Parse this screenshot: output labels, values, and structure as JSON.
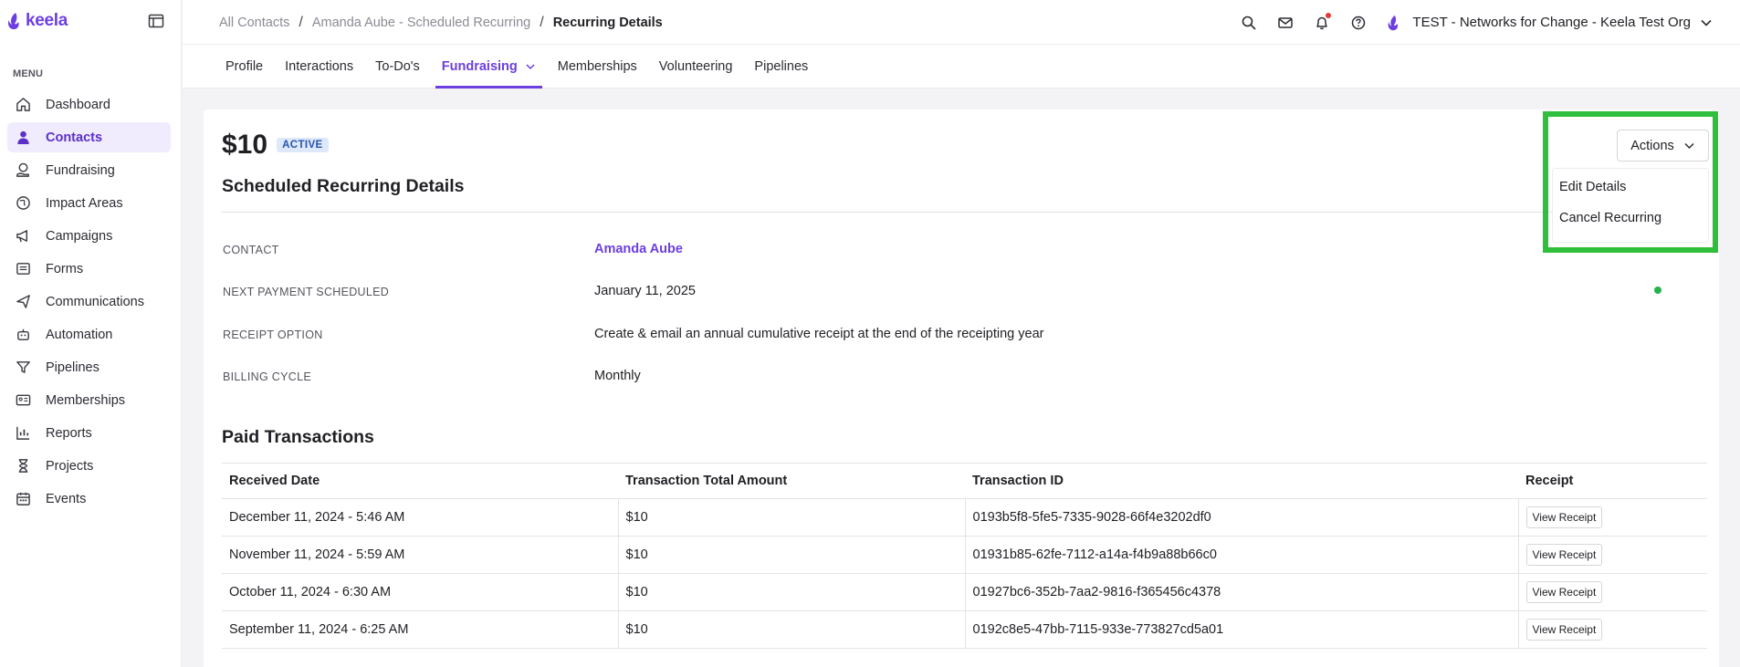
{
  "app": {
    "logo_text": "keela",
    "brand_color": "#6d3fe0",
    "highlight_color": "#2fbf3c"
  },
  "sidebar": {
    "menu_label": "MENU",
    "items": [
      {
        "label": "Dashboard",
        "icon": "home-icon"
      },
      {
        "label": "Contacts",
        "icon": "person-icon",
        "active": true
      },
      {
        "label": "Fundraising",
        "icon": "hand-coin-icon"
      },
      {
        "label": "Impact Areas",
        "icon": "globe-hand-icon"
      },
      {
        "label": "Campaigns",
        "icon": "megaphone-icon"
      },
      {
        "label": "Forms",
        "icon": "form-icon"
      },
      {
        "label": "Communications",
        "icon": "paper-plane-icon"
      },
      {
        "label": "Automation",
        "icon": "robot-icon"
      },
      {
        "label": "Pipelines",
        "icon": "funnel-icon"
      },
      {
        "label": "Memberships",
        "icon": "id-card-icon"
      },
      {
        "label": "Reports",
        "icon": "bar-chart-icon"
      },
      {
        "label": "Projects",
        "icon": "hourglass-icon"
      },
      {
        "label": "Events",
        "icon": "calendar-icon"
      }
    ]
  },
  "breadcrumb": {
    "items": [
      "All Contacts",
      "Amanda Aube - Scheduled Recurring"
    ],
    "current": "Recurring Details"
  },
  "header": {
    "org_name": "TEST - Networks for Change - Keela Test Org"
  },
  "tabs": [
    {
      "label": "Profile"
    },
    {
      "label": "Interactions"
    },
    {
      "label": "To-Do's"
    },
    {
      "label": "Fundraising",
      "active": true
    },
    {
      "label": "Memberships"
    },
    {
      "label": "Volunteering"
    },
    {
      "label": "Pipelines"
    }
  ],
  "recurring": {
    "amount": "$10",
    "status": "ACTIVE",
    "section_title": "Scheduled Recurring Details",
    "details": [
      {
        "label": "CONTACT",
        "value": "Amanda Aube"
      },
      {
        "label": "NEXT PAYMENT SCHEDULED",
        "value": "January 11, 2025"
      },
      {
        "label": "RECEIPT OPTION",
        "value": "Create & email an annual cumulative receipt at the end of the receipting year"
      },
      {
        "label": "BILLING CYCLE",
        "value": "Monthly"
      }
    ]
  },
  "actions": {
    "button_label": "Actions",
    "menu": [
      "Edit Details",
      "Cancel Recurring"
    ]
  },
  "transactions": {
    "title": "Paid Transactions",
    "columns": [
      "Received Date",
      "Transaction Total Amount",
      "Transaction ID",
      "Receipt"
    ],
    "receipt_label": "View Receipt",
    "rows": [
      {
        "date": "December 11, 2024 - 5:46 AM",
        "amount": "$10",
        "id": "0193b5f8-5fe5-7335-9028-66f4e3202df0"
      },
      {
        "date": "November 11, 2024 - 5:59 AM",
        "amount": "$10",
        "id": "01931b85-62fe-7112-a14a-f4b9a88b66c0"
      },
      {
        "date": "October 11, 2024 - 6:30 AM",
        "amount": "$10",
        "id": "01927bc6-352b-7aa2-9816-f365456c4378"
      },
      {
        "date": "September 11, 2024 - 6:25 AM",
        "amount": "$10",
        "id": "0192c8e5-47bb-7115-933e-773827cd5a01"
      }
    ]
  }
}
